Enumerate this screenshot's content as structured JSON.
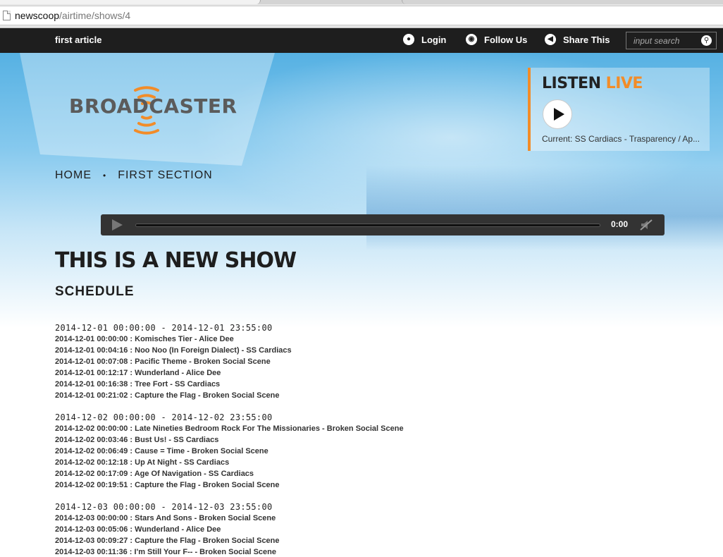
{
  "browser": {
    "url_host": "newscoop",
    "url_path": "/airtime/shows/4"
  },
  "topnav": {
    "first_article": "first article",
    "login": "Login",
    "follow_us": "Follow Us",
    "share_this": "Share This",
    "search_placeholder": "input search"
  },
  "logo": {
    "text": "BROADCASTER"
  },
  "breadcrumb": {
    "home": "HOME",
    "section": "FIRST SECTION"
  },
  "listen": {
    "title_part1": "LISTEN",
    "title_part2": "LIVE",
    "current": "Current: SS Cardiacs - Trasparency / Ap..."
  },
  "player": {
    "time": "0:00"
  },
  "show": {
    "title": "THIS IS A NEW SHOW",
    "schedule_label": "SCHEDULE"
  },
  "schedule": [
    {
      "range": "2014-12-01 00:00:00 - 2014-12-01 23:55:00",
      "tracks": [
        "2014-12-01 00:00:00 : Komisches Tier - Alice Dee",
        "2014-12-01 00:04:16 : Noo Noo (In Foreign Dialect) - SS Cardiacs",
        "2014-12-01 00:07:08 : Pacific Theme - Broken Social Scene",
        "2014-12-01 00:12:17 : Wunderland - Alice Dee",
        "2014-12-01 00:16:38 : Tree Fort - SS Cardiacs",
        "2014-12-01 00:21:02 : Capture the Flag - Broken Social Scene"
      ]
    },
    {
      "range": "2014-12-02 00:00:00 - 2014-12-02 23:55:00",
      "tracks": [
        "2014-12-02 00:00:00 : Late Nineties Bedroom Rock For The Missionaries - Broken Social Scene",
        "2014-12-02 00:03:46 : Bust Us! - SS Cardiacs",
        "2014-12-02 00:06:49 : Cause = Time - Broken Social Scene",
        "2014-12-02 00:12:18 : Up At Night - SS Cardiacs",
        "2014-12-02 00:17:09 : Age Of Navigation - SS Cardiacs",
        "2014-12-02 00:19:51 : Capture the Flag - Broken Social Scene"
      ]
    },
    {
      "range": "2014-12-03 00:00:00 - 2014-12-03 23:55:00",
      "tracks": [
        "2014-12-03 00:00:00 : Stars And Sons - Broken Social Scene",
        "2014-12-03 00:05:06 : Wunderland - Alice Dee",
        "2014-12-03 00:09:27 : Capture the Flag - Broken Social Scene",
        "2014-12-03 00:11:36 : I'm Still Your F-- - Broken Social Scene"
      ]
    }
  ],
  "colors": {
    "accent": "#f28c28",
    "nav_bg": "#1e1e1e",
    "sky": "#56b1e3"
  }
}
